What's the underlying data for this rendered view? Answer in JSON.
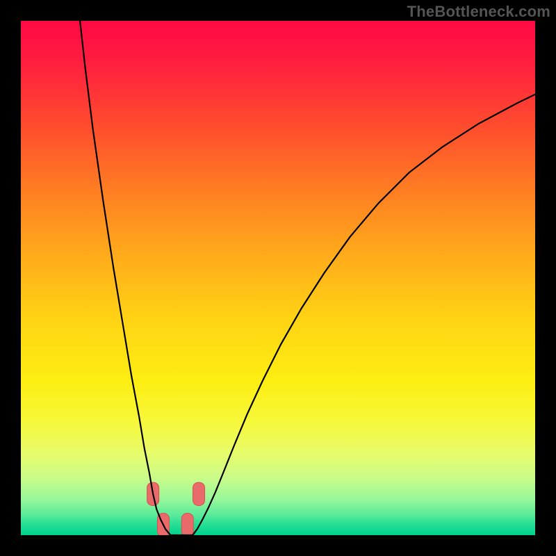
{
  "watermark": "TheBottleneck.com",
  "colors": {
    "frame": "#000000",
    "curve": "#000000",
    "stamp_fill": "#e96a6a",
    "stamp_stroke": "#d84e4e"
  },
  "chart_data": {
    "type": "line",
    "title": "",
    "xlabel": "",
    "ylabel": "",
    "xlim": [
      0,
      100
    ],
    "ylim": [
      0,
      100
    ],
    "grid": false,
    "legend": false,
    "series": [
      {
        "name": "left-branch",
        "x": [
          11.5,
          12.5,
          14,
          16,
          18,
          20,
          21.5,
          23,
          24,
          25,
          25.7,
          26.4,
          27.2,
          28.1,
          29.1
        ],
        "y": [
          100,
          91,
          79,
          65,
          52,
          40,
          31,
          23,
          17,
          12,
          8,
          5,
          3,
          1.2,
          0
        ]
      },
      {
        "name": "flat-bottom",
        "x": [
          29.1,
          30.5,
          32.0,
          33.4
        ],
        "y": [
          0,
          0,
          0,
          0
        ]
      },
      {
        "name": "right-branch",
        "x": [
          33.4,
          34.3,
          35.3,
          36.4,
          37.8,
          39.5,
          41.5,
          44,
          47,
          50.5,
          54.5,
          59,
          64,
          69.5,
          75.5,
          82,
          89,
          96.5,
          100
        ],
        "y": [
          0,
          1.2,
          3,
          5.2,
          8.3,
          12.5,
          17.5,
          23.5,
          30,
          37,
          44,
          51,
          58,
          64.5,
          70.5,
          75.5,
          80,
          84,
          85.7
        ]
      }
    ],
    "annotations": [
      {
        "kind": "marker",
        "shape": "rounded-rect",
        "x": 25.7,
        "y": 8,
        "w": 2.3,
        "h": 4.5
      },
      {
        "kind": "marker",
        "shape": "rounded-rect",
        "x": 27.7,
        "y": 2,
        "w": 2.3,
        "h": 4.5
      },
      {
        "kind": "marker",
        "shape": "rounded-rect",
        "x": 32.4,
        "y": 2,
        "w": 2.3,
        "h": 4.5
      },
      {
        "kind": "marker",
        "shape": "rounded-rect",
        "x": 34.6,
        "y": 8,
        "w": 2.3,
        "h": 4.5
      }
    ]
  }
}
